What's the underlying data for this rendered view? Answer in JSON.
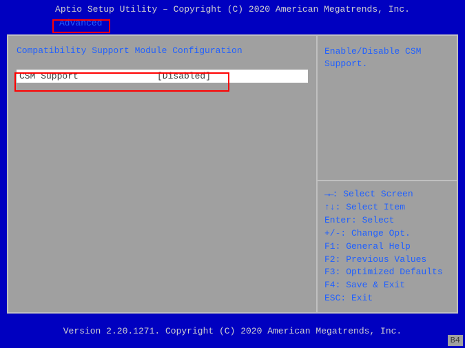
{
  "header": {
    "title": "Aptio Setup Utility – Copyright (C) 2020 American Megatrends, Inc."
  },
  "tab": {
    "label": "Advanced"
  },
  "main": {
    "section_title": "Compatibility Support Module Configuration",
    "setting": {
      "label": "CSM Support",
      "value": "[Disabled]"
    }
  },
  "sidebar": {
    "description": "Enable/Disable CSM Support.",
    "help": {
      "select_screen_icon": "→←",
      "select_screen": ": Select Screen",
      "select_item_icon": "↑↓",
      "select_item": ": Select Item",
      "enter": "Enter: Select",
      "change_opt": "+/-: Change Opt.",
      "f1": "F1: General Help",
      "f2": "F2: Previous Values",
      "f3": "F3: Optimized Defaults",
      "f4": "F4: Save & Exit",
      "esc": "ESC: Exit"
    }
  },
  "footer": {
    "text": "Version 2.20.1271. Copyright (C) 2020 American Megatrends, Inc."
  },
  "badge": {
    "text": "B4"
  }
}
